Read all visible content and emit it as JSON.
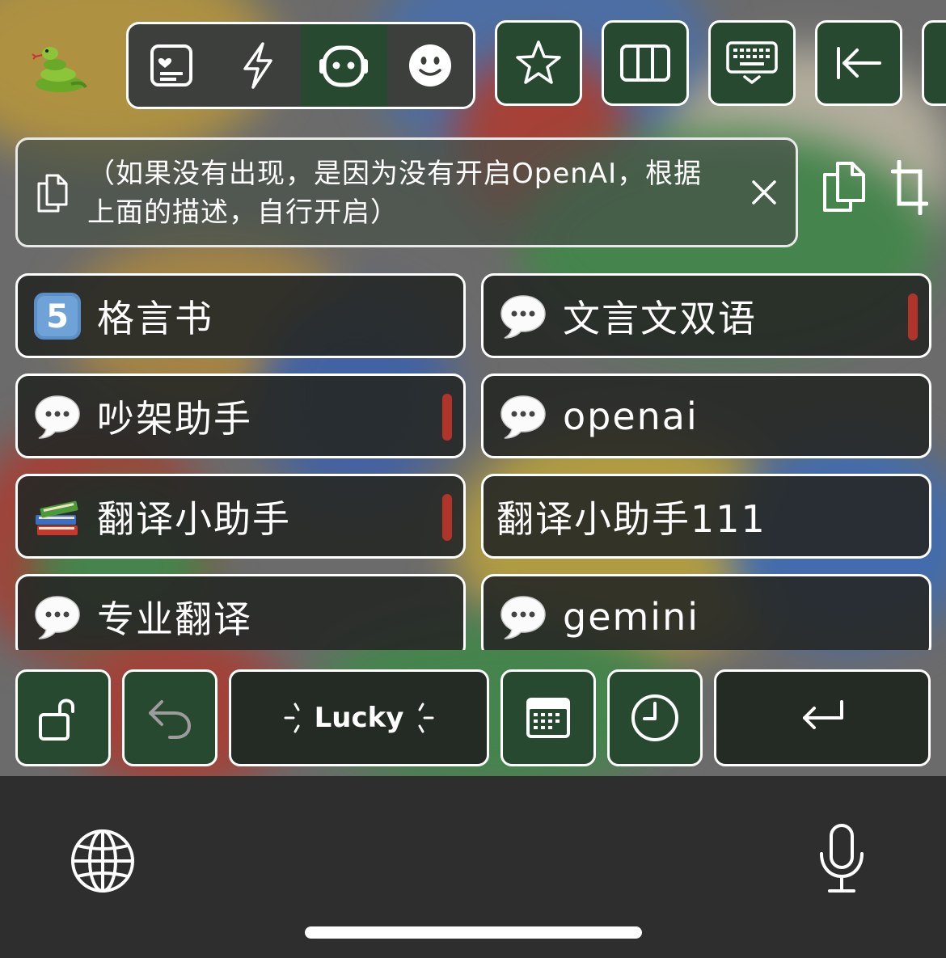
{
  "toolbar": {
    "app_icon": "snake-emoji",
    "tabs": [
      {
        "icon": "notes-card-icon",
        "active": false
      },
      {
        "icon": "lightning-icon",
        "active": false
      },
      {
        "icon": "robot-face-icon",
        "active": true
      },
      {
        "icon": "smiley-icon",
        "active": false
      }
    ],
    "buttons": [
      "star-icon",
      "columns-icon",
      "keyboard-icon",
      "back-arrow-icon"
    ]
  },
  "clipboard": {
    "text": "（如果没有出现，是因为没有开启OpenAI，根据上面的描述，自行开启）"
  },
  "prompts": [
    {
      "icon": "keycap-5-emoji",
      "label": "格言书",
      "marked": false
    },
    {
      "icon": "speech-bubble-emoji",
      "label": "文言文双语",
      "marked": true
    },
    {
      "icon": "speech-bubble-emoji",
      "label": "吵架助手",
      "marked": true
    },
    {
      "icon": "speech-bubble-emoji",
      "label": "openai",
      "marked": false
    },
    {
      "icon": "books-emoji",
      "label": "翻译小助手",
      "marked": true
    },
    {
      "icon": "",
      "label": "翻译小助手111",
      "marked": false
    },
    {
      "icon": "speech-bubble-emoji",
      "label": "专业翻译",
      "marked": false
    },
    {
      "icon": "speech-bubble-emoji",
      "label": "gemini",
      "marked": false
    }
  ],
  "actions": {
    "lucky_label": "Lucky"
  },
  "colors": {
    "key_green": "#27492f",
    "mark_red": "#b0342a",
    "bottom_bar": "#2e2e2e"
  }
}
